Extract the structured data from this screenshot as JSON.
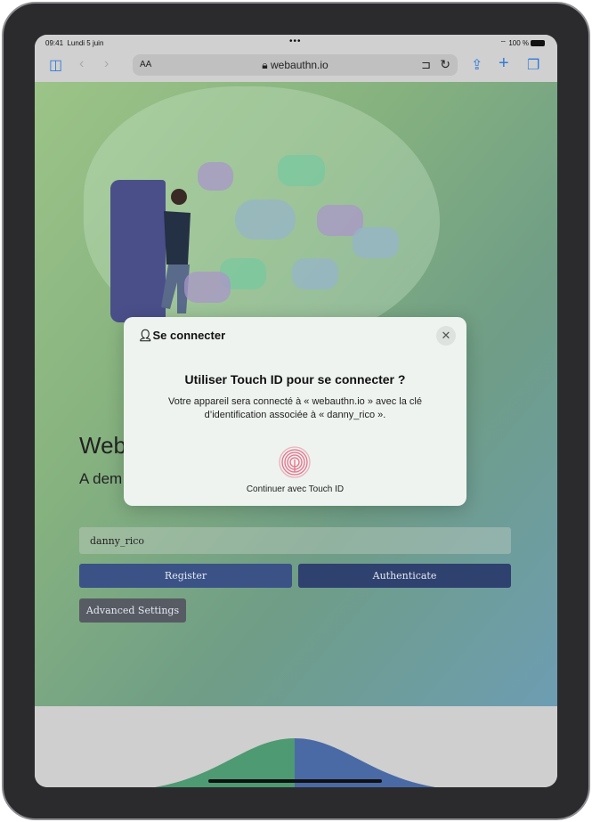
{
  "status_bar": {
    "time": "09:41",
    "date": "Lundi 5 juin",
    "battery": "100 %"
  },
  "browser": {
    "text_size_label": "AA",
    "url": "webauthn.io",
    "icons": [
      "sidebar-icon",
      "back-icon",
      "forward-icon",
      "lock-icon",
      "extension-icon",
      "reload-icon",
      "share-icon",
      "new-tab-icon",
      "tabs-icon"
    ]
  },
  "page": {
    "heading": "Web",
    "subheading": "A dem",
    "username_value": "danny_rico",
    "register_label": "Register",
    "authenticate_label": "Authenticate",
    "advanced_label": "Advanced Settings"
  },
  "dialog": {
    "title": "Se connecter",
    "question": "Utiliser Touch ID pour se connecter ?",
    "message": "Votre appareil sera connecté à « webauthn.io » avec la clé d’identification associée à « danny_rico ».",
    "continue_label": "Continuer avec Touch ID",
    "fingerprint_color": "#e8708a"
  },
  "colors": {
    "register": "#3a5286",
    "authenticate": "#2f416e",
    "advanced": "#575b63"
  }
}
